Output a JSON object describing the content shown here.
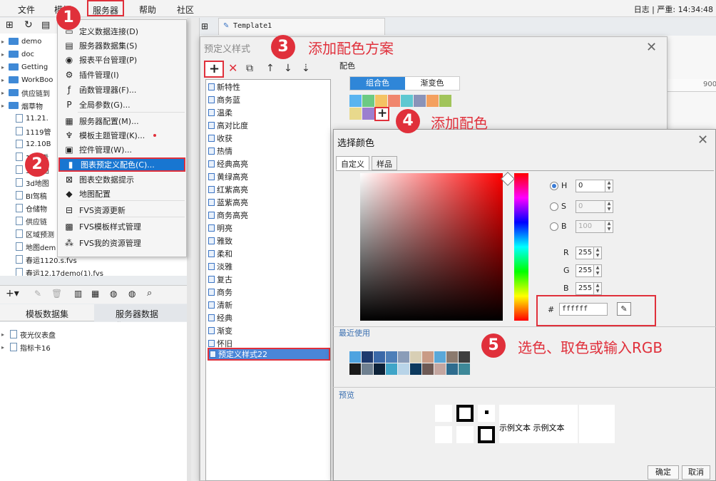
{
  "menubar": {
    "items": [
      "文件",
      "模板",
      "服务器",
      "帮助",
      "社区"
    ],
    "log": "日志",
    "severity": "严重: 14:34:48"
  },
  "tree": {
    "items": [
      "demo",
      "doc",
      "Getting",
      "WorkBoo",
      "供应链到",
      "烟草物",
      "11.21.",
      "1119管",
      "12.10B",
      "12.9看",
      "3d地图",
      "3d地图",
      "BI驾稿",
      "仓储物",
      "供应链",
      "区域预测",
      "地图dem",
      "春运1120.s.fvs",
      "春运12.17demo(1).fvs"
    ]
  },
  "datasets": {
    "tabs": [
      "模板数据集",
      "服务器数据集"
    ],
    "items": [
      "夜光仪表盘",
      "指标卡16"
    ]
  },
  "template_tab": "Template1",
  "server_menu": {
    "items": [
      "定义数据连接(D)",
      "服务器数据集(S)",
      "报表平台管理(P)",
      "插件管理(I)",
      "函数管理器(F)...",
      "全局参数(G)...",
      "服务器配置(M)...",
      "模板主题管理(K)...",
      "控件管理(W)...",
      "图表预定义配色(C)...",
      "图表空数据提示",
      "地图配置",
      "FVS资源更新",
      "FVS模板样式管理",
      "FVS我的资源管理"
    ],
    "icons": [
      "db-icon",
      "dataset-icon",
      "user-icon",
      "gear-icon",
      "function-icon",
      "param-icon",
      "server-icon",
      "shirt-icon",
      "widget-icon",
      "chart-icon",
      "empty-icon",
      "map-icon",
      "refresh-icon",
      "fvs-icon",
      "cube-icon"
    ]
  },
  "style_dialog": {
    "title": "预定义样式",
    "color_label": "配色",
    "seg_combo": "组合色",
    "seg_gradient": "渐变色",
    "styles": [
      "新特性",
      "商务蓝",
      "温柔",
      "高对比度",
      "收获",
      "热情",
      "经典高亮",
      "黄绿高亮",
      "红紫高亮",
      "蓝紫高亮",
      "商务高亮",
      "明亮",
      "雅致",
      "柔和",
      "淡雅",
      "复古",
      "商务",
      "清新",
      "经典",
      "渐变",
      "怀旧",
      "预定义样式22"
    ],
    "swatches": [
      "#5ab4f0",
      "#6cca83",
      "#f4c363",
      "#f0866d",
      "#5fc8d1",
      "#8a93b9",
      "#f4a05f",
      "#a1c45a",
      "#e8d98c",
      "#9c7fcf"
    ]
  },
  "color_dialog": {
    "title": "选择颜色",
    "tabs": [
      "自定义",
      "样品"
    ],
    "h_label": "H",
    "s_label": "S",
    "b_label": "B",
    "h_value": "0",
    "s_value": "0",
    "b_value": "100",
    "r_label": "R",
    "g_label": "G",
    "b2_label": "B",
    "r_value": "255",
    "g_value": "255",
    "b2_value": "255",
    "hash": "#",
    "hex": "ffffff",
    "recent_label": "最近使用",
    "recent_colors": [
      "#4ea3e0",
      "#1e3a6e",
      "#3a68a8",
      "#4d7eb8",
      "#8a9cb8",
      "#d8cfb5",
      "#c99b85",
      "#5aa8d8",
      "#8b7a6e",
      "#3e3e3e",
      "#1a1a1a",
      "#6f8090",
      "#0d2238",
      "#3fa5c8",
      "#b8d4e8",
      "#0d3a5e",
      "#6e5a55",
      "#c4a6a0",
      "#2e6c8e",
      "#3d8898"
    ],
    "preview_label": "预览",
    "sample_text": "示例文本",
    "ok": "确定",
    "cancel": "取消"
  },
  "callouts": {
    "n1": "1",
    "n2": "2",
    "n3": "3",
    "n4": "4",
    "n5": "5",
    "t3": "添加配色方案",
    "t4": "添加配色",
    "t5": "选色、取色或输入RGB"
  },
  "ruler": {
    "mark": "900"
  }
}
